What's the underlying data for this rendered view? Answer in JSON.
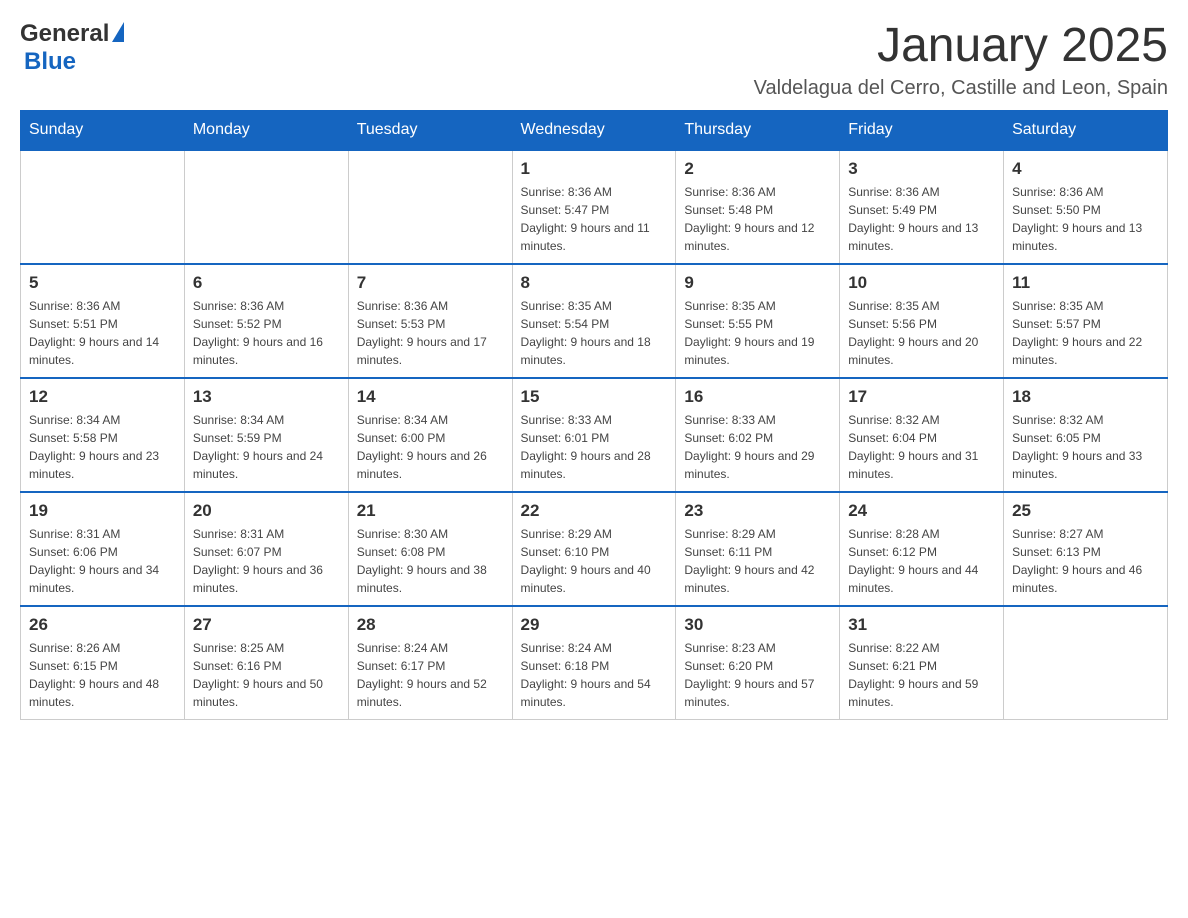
{
  "logo": {
    "general": "General",
    "blue": "Blue"
  },
  "header": {
    "month": "January 2025",
    "location": "Valdelagua del Cerro, Castille and Leon, Spain"
  },
  "days_of_week": [
    "Sunday",
    "Monday",
    "Tuesday",
    "Wednesday",
    "Thursday",
    "Friday",
    "Saturday"
  ],
  "weeks": [
    [
      {
        "day": "",
        "sunrise": "",
        "sunset": "",
        "daylight": ""
      },
      {
        "day": "",
        "sunrise": "",
        "sunset": "",
        "daylight": ""
      },
      {
        "day": "",
        "sunrise": "",
        "sunset": "",
        "daylight": ""
      },
      {
        "day": "1",
        "sunrise": "Sunrise: 8:36 AM",
        "sunset": "Sunset: 5:47 PM",
        "daylight": "Daylight: 9 hours and 11 minutes."
      },
      {
        "day": "2",
        "sunrise": "Sunrise: 8:36 AM",
        "sunset": "Sunset: 5:48 PM",
        "daylight": "Daylight: 9 hours and 12 minutes."
      },
      {
        "day": "3",
        "sunrise": "Sunrise: 8:36 AM",
        "sunset": "Sunset: 5:49 PM",
        "daylight": "Daylight: 9 hours and 13 minutes."
      },
      {
        "day": "4",
        "sunrise": "Sunrise: 8:36 AM",
        "sunset": "Sunset: 5:50 PM",
        "daylight": "Daylight: 9 hours and 13 minutes."
      }
    ],
    [
      {
        "day": "5",
        "sunrise": "Sunrise: 8:36 AM",
        "sunset": "Sunset: 5:51 PM",
        "daylight": "Daylight: 9 hours and 14 minutes."
      },
      {
        "day": "6",
        "sunrise": "Sunrise: 8:36 AM",
        "sunset": "Sunset: 5:52 PM",
        "daylight": "Daylight: 9 hours and 16 minutes."
      },
      {
        "day": "7",
        "sunrise": "Sunrise: 8:36 AM",
        "sunset": "Sunset: 5:53 PM",
        "daylight": "Daylight: 9 hours and 17 minutes."
      },
      {
        "day": "8",
        "sunrise": "Sunrise: 8:35 AM",
        "sunset": "Sunset: 5:54 PM",
        "daylight": "Daylight: 9 hours and 18 minutes."
      },
      {
        "day": "9",
        "sunrise": "Sunrise: 8:35 AM",
        "sunset": "Sunset: 5:55 PM",
        "daylight": "Daylight: 9 hours and 19 minutes."
      },
      {
        "day": "10",
        "sunrise": "Sunrise: 8:35 AM",
        "sunset": "Sunset: 5:56 PM",
        "daylight": "Daylight: 9 hours and 20 minutes."
      },
      {
        "day": "11",
        "sunrise": "Sunrise: 8:35 AM",
        "sunset": "Sunset: 5:57 PM",
        "daylight": "Daylight: 9 hours and 22 minutes."
      }
    ],
    [
      {
        "day": "12",
        "sunrise": "Sunrise: 8:34 AM",
        "sunset": "Sunset: 5:58 PM",
        "daylight": "Daylight: 9 hours and 23 minutes."
      },
      {
        "day": "13",
        "sunrise": "Sunrise: 8:34 AM",
        "sunset": "Sunset: 5:59 PM",
        "daylight": "Daylight: 9 hours and 24 minutes."
      },
      {
        "day": "14",
        "sunrise": "Sunrise: 8:34 AM",
        "sunset": "Sunset: 6:00 PM",
        "daylight": "Daylight: 9 hours and 26 minutes."
      },
      {
        "day": "15",
        "sunrise": "Sunrise: 8:33 AM",
        "sunset": "Sunset: 6:01 PM",
        "daylight": "Daylight: 9 hours and 28 minutes."
      },
      {
        "day": "16",
        "sunrise": "Sunrise: 8:33 AM",
        "sunset": "Sunset: 6:02 PM",
        "daylight": "Daylight: 9 hours and 29 minutes."
      },
      {
        "day": "17",
        "sunrise": "Sunrise: 8:32 AM",
        "sunset": "Sunset: 6:04 PM",
        "daylight": "Daylight: 9 hours and 31 minutes."
      },
      {
        "day": "18",
        "sunrise": "Sunrise: 8:32 AM",
        "sunset": "Sunset: 6:05 PM",
        "daylight": "Daylight: 9 hours and 33 minutes."
      }
    ],
    [
      {
        "day": "19",
        "sunrise": "Sunrise: 8:31 AM",
        "sunset": "Sunset: 6:06 PM",
        "daylight": "Daylight: 9 hours and 34 minutes."
      },
      {
        "day": "20",
        "sunrise": "Sunrise: 8:31 AM",
        "sunset": "Sunset: 6:07 PM",
        "daylight": "Daylight: 9 hours and 36 minutes."
      },
      {
        "day": "21",
        "sunrise": "Sunrise: 8:30 AM",
        "sunset": "Sunset: 6:08 PM",
        "daylight": "Daylight: 9 hours and 38 minutes."
      },
      {
        "day": "22",
        "sunrise": "Sunrise: 8:29 AM",
        "sunset": "Sunset: 6:10 PM",
        "daylight": "Daylight: 9 hours and 40 minutes."
      },
      {
        "day": "23",
        "sunrise": "Sunrise: 8:29 AM",
        "sunset": "Sunset: 6:11 PM",
        "daylight": "Daylight: 9 hours and 42 minutes."
      },
      {
        "day": "24",
        "sunrise": "Sunrise: 8:28 AM",
        "sunset": "Sunset: 6:12 PM",
        "daylight": "Daylight: 9 hours and 44 minutes."
      },
      {
        "day": "25",
        "sunrise": "Sunrise: 8:27 AM",
        "sunset": "Sunset: 6:13 PM",
        "daylight": "Daylight: 9 hours and 46 minutes."
      }
    ],
    [
      {
        "day": "26",
        "sunrise": "Sunrise: 8:26 AM",
        "sunset": "Sunset: 6:15 PM",
        "daylight": "Daylight: 9 hours and 48 minutes."
      },
      {
        "day": "27",
        "sunrise": "Sunrise: 8:25 AM",
        "sunset": "Sunset: 6:16 PM",
        "daylight": "Daylight: 9 hours and 50 minutes."
      },
      {
        "day": "28",
        "sunrise": "Sunrise: 8:24 AM",
        "sunset": "Sunset: 6:17 PM",
        "daylight": "Daylight: 9 hours and 52 minutes."
      },
      {
        "day": "29",
        "sunrise": "Sunrise: 8:24 AM",
        "sunset": "Sunset: 6:18 PM",
        "daylight": "Daylight: 9 hours and 54 minutes."
      },
      {
        "day": "30",
        "sunrise": "Sunrise: 8:23 AM",
        "sunset": "Sunset: 6:20 PM",
        "daylight": "Daylight: 9 hours and 57 minutes."
      },
      {
        "day": "31",
        "sunrise": "Sunrise: 8:22 AM",
        "sunset": "Sunset: 6:21 PM",
        "daylight": "Daylight: 9 hours and 59 minutes."
      },
      {
        "day": "",
        "sunrise": "",
        "sunset": "",
        "daylight": ""
      }
    ]
  ]
}
